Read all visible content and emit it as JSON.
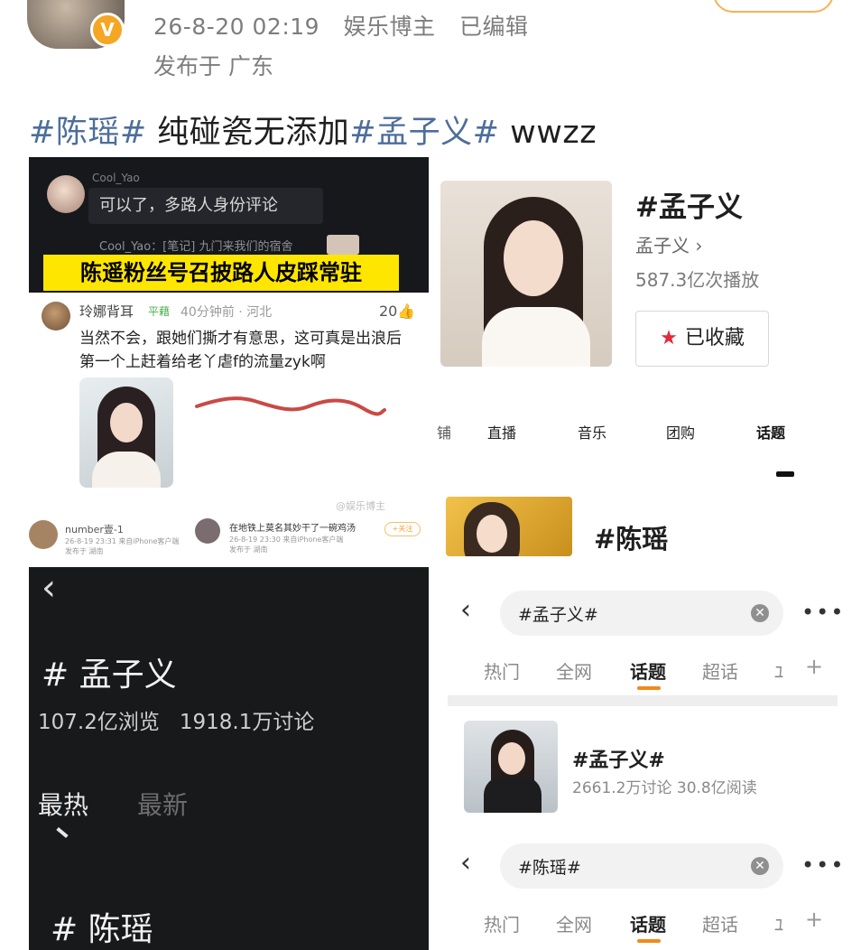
{
  "header": {
    "timestamp": "26-8-20 02:19",
    "category": "娱乐博主",
    "edited": "已编辑",
    "location": "发布于 广东",
    "verified_badge": "V"
  },
  "post": {
    "tag1": "#陈瑶#",
    "text1": " 纯碰瓷无添加",
    "tag2": "#孟子义#",
    "text2": " wwzz"
  },
  "panel1": {
    "username": "Cool_Yao",
    "message": "可以了，多路人身份评论",
    "line2": "Cool_Yao：[笔记] 九门来我们的宿舍",
    "banner": "陈遥粉丝号召披路人皮踩常驻"
  },
  "panel2": {
    "user": "玲娜背耳",
    "tag": "平藉",
    "time": "40分钟前 · 河北",
    "likes": "20👍",
    "comment": "当然不会，跟她们撕才有意思，这可真是出浪后第一个上赶着给老丫虐f的流量zyk啊"
  },
  "panel3": {
    "watermark": "@娱乐博主",
    "user1": "number壹-1",
    "meta1": "26-8-19 23:31 来自iPhone客户端",
    "meta1b": "发布于 湖南",
    "text2": "在地铁上莫名其妙干了一碗鸡汤",
    "meta2": "26-8-19 23:30 来自iPhone客户端",
    "meta2b": "发布于 湖南",
    "follow": "+关注"
  },
  "panel4": {
    "title": "# 孟子义",
    "views": "107.2亿浏览",
    "discussions": "1918.1万讨论",
    "tab_hot": "最热",
    "tab_new": "最新",
    "title2": "# 陈瑶"
  },
  "panel5": {
    "title": "#孟子义",
    "author": "孟子义 ›",
    "plays": "587.3亿次播放",
    "collect_button": "已收藏"
  },
  "panel6": {
    "tabs": [
      "铺",
      "直播",
      "音乐",
      "团购",
      "话题"
    ],
    "active_tab": "话题",
    "result_title": "#陈瑶"
  },
  "search1": {
    "query": "#孟子义#",
    "tabs": [
      "热门",
      "全网",
      "话题",
      "超话",
      "ﾕ"
    ],
    "active_tab": "话题",
    "result_title": "#孟子义#",
    "result_meta": "2661.2万讨论 30.8亿阅读"
  },
  "search2": {
    "query": "#陈瑶#",
    "tabs": [
      "热门",
      "全网",
      "话题",
      "超话",
      "ﾕ"
    ],
    "active_tab": "话题"
  },
  "icons": {
    "back": "‹",
    "more": "•••",
    "clear": "✕",
    "plus": "+",
    "star": "★"
  },
  "colors": {
    "hashtag": "#4d6e9a",
    "banner": "#ffe600",
    "accent": "#f08a1a",
    "star": "#e4293a"
  }
}
